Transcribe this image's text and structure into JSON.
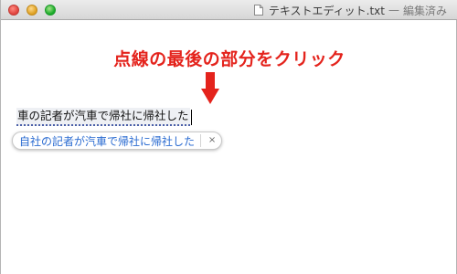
{
  "window": {
    "filename": "テキストエディット.txt",
    "separator": "—",
    "status": "編集済み"
  },
  "instruction": {
    "text": "点線の最後の部分をクリック",
    "color": "#e4231c"
  },
  "document": {
    "marked_text": "車の記者が汽車で帰社に帰社した"
  },
  "suggestion": {
    "text": "自社の記者が汽車で帰社に帰社した",
    "dismiss_label": "×",
    "text_color": "#2a6bd1"
  },
  "icons": {
    "traffic_lights": [
      "close-icon",
      "minimize-icon",
      "zoom-icon"
    ],
    "document": "document-icon",
    "arrow": "down-arrow-icon"
  }
}
